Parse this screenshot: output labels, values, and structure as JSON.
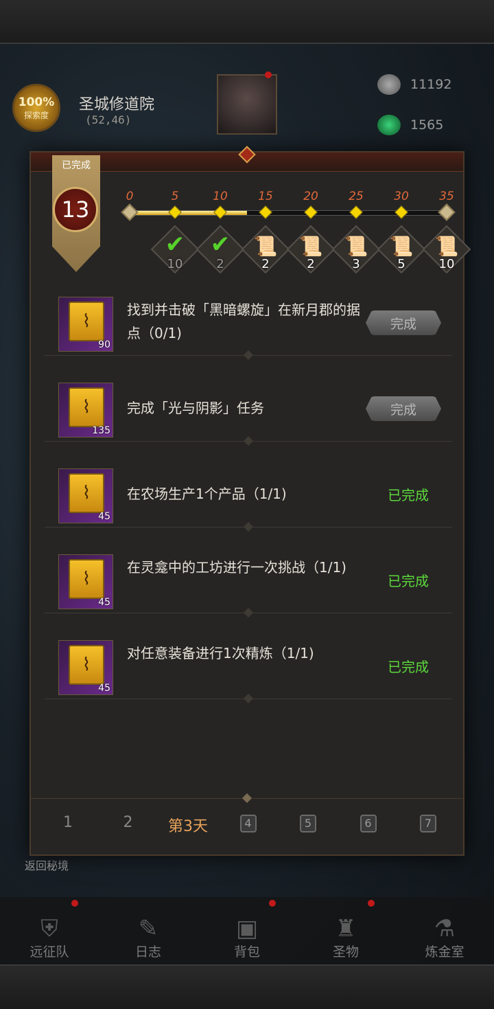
{
  "hud": {
    "explore_percent": "100%",
    "explore_label": "探索度",
    "location_name": "圣城修道院",
    "location_coords": "(52,46)",
    "resource_1": "11192",
    "resource_2": "1565"
  },
  "back_link": "返回秘境",
  "nav": [
    {
      "label": "远征队",
      "icon": "helmet-icon",
      "badge": true
    },
    {
      "label": "日志",
      "icon": "journal-icon",
      "badge": false
    },
    {
      "label": "背包",
      "icon": "backpack-icon",
      "badge": true
    },
    {
      "label": "圣物",
      "icon": "relic-icon",
      "badge": true
    },
    {
      "label": "炼金室",
      "icon": "alchemy-icon",
      "badge": false
    }
  ],
  "modal": {
    "banner_label": "已完成",
    "level": "13",
    "progress_fraction": 0.37,
    "milestones": [
      "0",
      "5",
      "10",
      "15",
      "20",
      "25",
      "30",
      "35"
    ],
    "rewards": [
      {
        "count": "10",
        "claimed": true,
        "icon": "check-icon"
      },
      {
        "count": "2",
        "claimed": true,
        "icon": "check-icon"
      },
      {
        "count": "2",
        "claimed": false,
        "icon": "scroll-icon"
      },
      {
        "count": "2",
        "claimed": false,
        "icon": "scroll-icon"
      },
      {
        "count": "3",
        "claimed": false,
        "icon": "scroll-icon"
      },
      {
        "count": "5",
        "claimed": false,
        "icon": "scroll-icon"
      },
      {
        "count": "10",
        "claimed": false,
        "icon": "scroll-icon"
      }
    ],
    "tasks": [
      {
        "text": "找到并击破「黑暗螺旋」在新月郡的据点（0/1)",
        "qty": "90",
        "status": "button",
        "button_label": "完成"
      },
      {
        "text": "完成「光与阴影」任务",
        "qty": "135",
        "status": "button",
        "button_label": "完成"
      },
      {
        "text": "在农场生产1个产品（1/1)",
        "qty": "45",
        "status": "done",
        "done_label": "已完成"
      },
      {
        "text": "在灵龛中的工坊进行一次挑战（1/1)",
        "qty": "45",
        "status": "done",
        "done_label": "已完成"
      },
      {
        "text": "对任意装备进行1次精炼（1/1)",
        "qty": "45",
        "status": "done",
        "done_label": "已完成"
      }
    ],
    "days": [
      {
        "label": "1",
        "locked": false,
        "active": false
      },
      {
        "label": "2",
        "locked": false,
        "active": false
      },
      {
        "label": "第3天",
        "locked": false,
        "active": true
      },
      {
        "label": "4",
        "locked": true,
        "active": false
      },
      {
        "label": "5",
        "locked": true,
        "active": false
      },
      {
        "label": "6",
        "locked": true,
        "active": false
      },
      {
        "label": "7",
        "locked": true,
        "active": false
      }
    ]
  }
}
